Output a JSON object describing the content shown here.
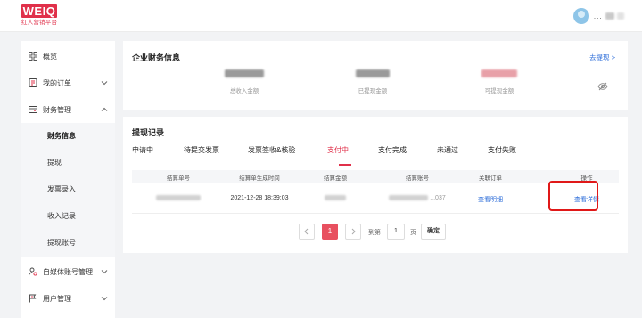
{
  "header": {
    "logo_main": "WEIQ",
    "logo_sub": "红人营销平台",
    "user_name": "..."
  },
  "sidebar": {
    "items": [
      {
        "label": "概览",
        "icon": "grid-icon"
      },
      {
        "label": "我的订单",
        "icon": "order-icon"
      },
      {
        "label": "财务管理",
        "icon": "finance-icon"
      },
      {
        "label": "自媒体账号管理",
        "icon": "account-icon"
      },
      {
        "label": "用户管理",
        "icon": "user-flag-icon"
      }
    ],
    "finance_sub": [
      "财务信息",
      "提现",
      "发票录入",
      "收入记录",
      "提现账号"
    ]
  },
  "finance": {
    "title": "企业财务信息",
    "withdraw_link": "去提现 >",
    "stats": [
      {
        "label": "总收入金额"
      },
      {
        "label": "已提现金额"
      },
      {
        "label": "可提现金额"
      }
    ]
  },
  "records": {
    "title": "提现记录",
    "tabs": [
      "申请中",
      "待提交发票",
      "发票签收&核验",
      "支付中",
      "支付完成",
      "未通过",
      "支付失败"
    ],
    "active_tab": 3,
    "columns": [
      "结算单号",
      "结算单生成时间",
      "结算金额",
      "结算账号",
      "关联订单",
      "操作"
    ],
    "rows": [
      {
        "time": "2021-12-28 18:39:03",
        "account_suffix": "...037",
        "order_link": "查看明细",
        "action": "查看详情"
      }
    ]
  },
  "pagination": {
    "current": "1",
    "goto_prefix": "到第",
    "goto_value": "1",
    "goto_suffix": "页",
    "confirm": "确定"
  },
  "colors": {
    "brand": "#e0304a",
    "link": "#2a6bd8",
    "highlight": "#e01818"
  }
}
